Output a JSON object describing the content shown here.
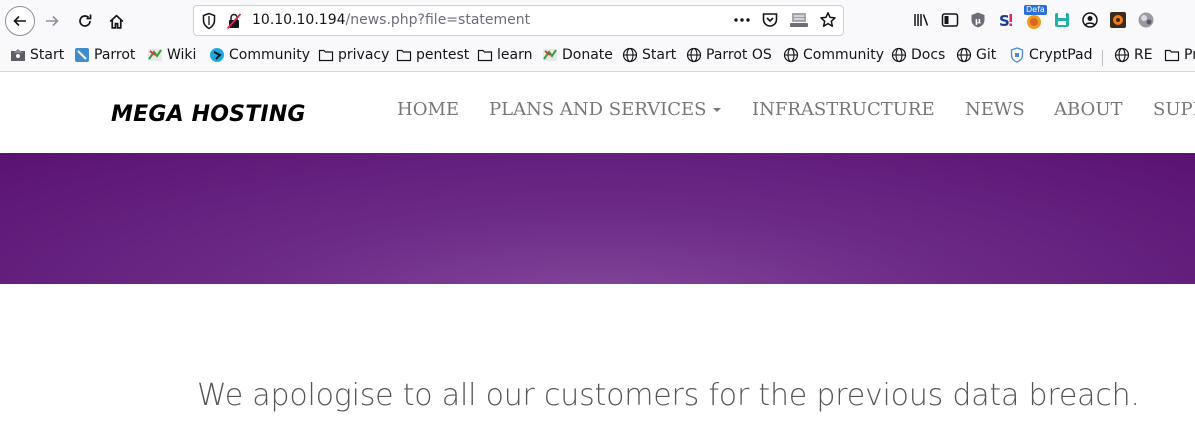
{
  "browser": {
    "url_host": "10.10.10.194",
    "url_path": "/news.php?file=statement",
    "ext_badge": "Defa"
  },
  "bookmarks": [
    {
      "label": "Start",
      "icon": "start-icon"
    },
    {
      "label": "Parrot",
      "icon": "parrot-icon"
    },
    {
      "label": "Wiki",
      "icon": "wiki-icon"
    },
    {
      "label": "Community",
      "icon": "community-icon"
    },
    {
      "label": "privacy",
      "icon": "folder-icon"
    },
    {
      "label": "pentest",
      "icon": "folder-icon"
    },
    {
      "label": "learn",
      "icon": "folder-icon"
    },
    {
      "label": "Donate",
      "icon": "donate-icon"
    },
    {
      "label": "Start",
      "icon": "globe-icon"
    },
    {
      "label": "Parrot OS",
      "icon": "globe-icon"
    },
    {
      "label": "Community",
      "icon": "globe-icon"
    },
    {
      "label": "Docs",
      "icon": "globe-icon"
    },
    {
      "label": "Git",
      "icon": "globe-icon"
    },
    {
      "label": "CryptPad",
      "icon": "cryptpad-icon"
    },
    {
      "label": "RE",
      "icon": "globe-icon"
    },
    {
      "label": "Pr",
      "icon": "folder-icon"
    }
  ],
  "site": {
    "logo": "MEGA HOSTING",
    "menu": [
      {
        "label": "HOME"
      },
      {
        "label": "PLANS AND SERVICES"
      },
      {
        "label": "INFRASTRUCTURE"
      },
      {
        "label": "NEWS"
      },
      {
        "label": "ABOUT"
      },
      {
        "label": "SUPPORT"
      }
    ],
    "headline": "We apologise to all our customers for the previous data breach."
  },
  "colors": {
    "hero_purple": "#6d2c88",
    "menu_text": "#777777",
    "headline_text": "#555555"
  }
}
